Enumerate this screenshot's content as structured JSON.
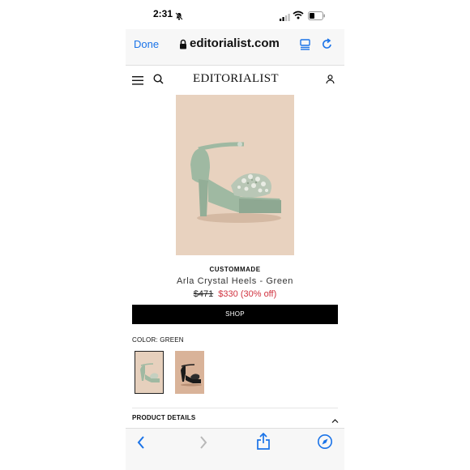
{
  "status": {
    "time": "2:31"
  },
  "browser": {
    "done_label": "Done",
    "url": "editorialist.com"
  },
  "site": {
    "logo": "EDITORIALIST"
  },
  "product": {
    "brand": "CUSTOMMADE",
    "name": "Arla Crystal Heels - Green",
    "price_old": "$471",
    "price_new": "$330",
    "price_off": "(30% off)",
    "shop_label": "SHOP",
    "color_label": "COLOR: GREEN",
    "details_label": "PRODUCT DETAILS"
  },
  "colors": {
    "accent": "#1a73e8",
    "sale": "#d0313e",
    "shoe_green": "#9fb9a2",
    "image_bg": "#e8d2bf"
  },
  "icons": [
    "bell-off-icon",
    "signal-icon",
    "wifi-icon",
    "battery-icon",
    "lock-icon",
    "reader-icon",
    "reload-icon",
    "menu-icon",
    "search-icon",
    "account-icon",
    "chevron-up-icon",
    "back-icon",
    "forward-icon",
    "share-icon",
    "compass-icon"
  ]
}
